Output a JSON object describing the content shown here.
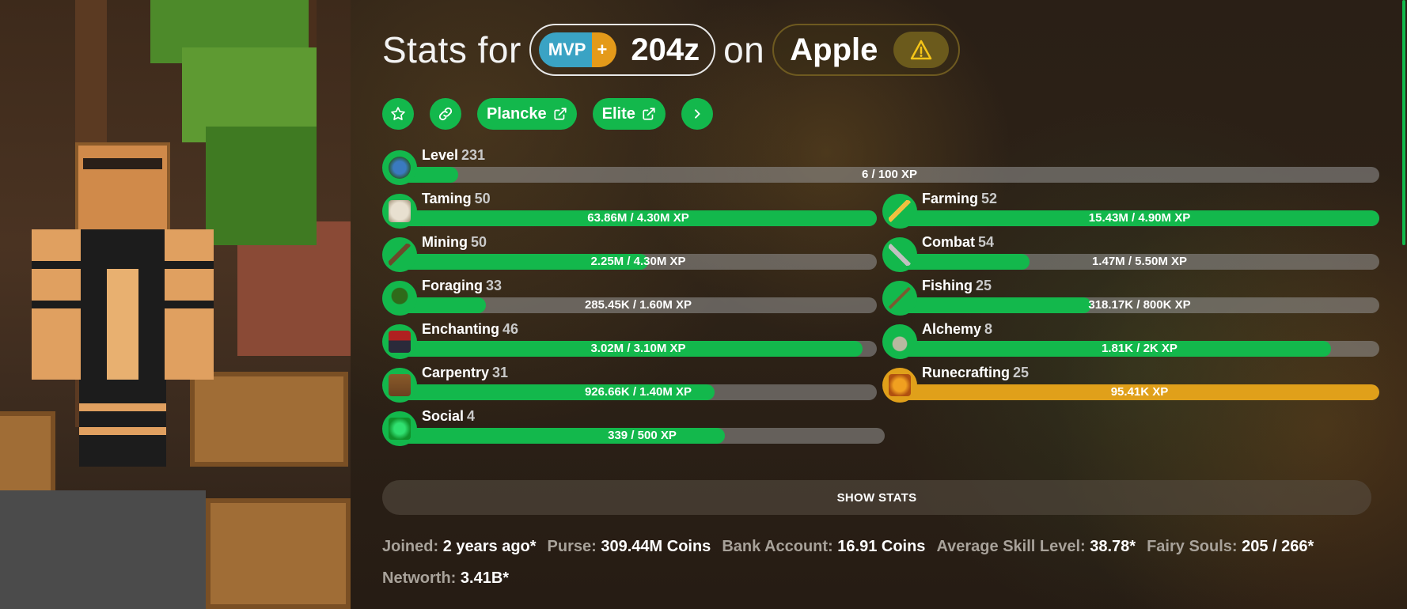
{
  "header": {
    "stats_for": "Stats for",
    "rank_main": "MVP",
    "rank_plus": "+",
    "player": "204z",
    "on": "on",
    "profile": "Apple",
    "warning_icon": "warning-triangle-icon"
  },
  "links": {
    "favorite_icon": "star-icon",
    "share_icon": "link-icon",
    "plancke": "Plancke",
    "elite": "Elite",
    "more_icon": "chevron-right-icon"
  },
  "level": {
    "name": "Level",
    "value": "231",
    "xp": "6 / 100 XP",
    "progress": 0.06
  },
  "skills": [
    {
      "name": "Taming",
      "level": "50",
      "xp": "63.86M / 4.30M XP",
      "progress": 1.0,
      "icon": "spawn-egg-icon",
      "color": "#13b84c"
    },
    {
      "name": "Farming",
      "level": "52",
      "xp": "15.43M / 4.90M XP",
      "progress": 1.0,
      "icon": "golden-hoe-icon",
      "color": "#13b84c"
    },
    {
      "name": "Mining",
      "level": "50",
      "xp": "2.25M / 4.30M XP",
      "progress": 0.52,
      "icon": "pickaxe-icon",
      "color": "#13b84c"
    },
    {
      "name": "Combat",
      "level": "54",
      "xp": "1.47M / 5.50M XP",
      "progress": 0.27,
      "icon": "sword-icon",
      "color": "#13b84c"
    },
    {
      "name": "Foraging",
      "level": "33",
      "xp": "285.45K / 1.60M XP",
      "progress": 0.18,
      "icon": "sapling-icon",
      "color": "#13b84c"
    },
    {
      "name": "Fishing",
      "level": "25",
      "xp": "318.17K / 800K XP",
      "progress": 0.4,
      "icon": "fishing-rod-icon",
      "color": "#13b84c"
    },
    {
      "name": "Enchanting",
      "level": "46",
      "xp": "3.02M / 3.10M XP",
      "progress": 0.97,
      "icon": "enchanting-table-icon",
      "color": "#13b84c"
    },
    {
      "name": "Alchemy",
      "level": "8",
      "xp": "1.81K / 2K XP",
      "progress": 0.9,
      "icon": "brewing-stand-icon",
      "color": "#13b84c"
    },
    {
      "name": "Carpentry",
      "level": "31",
      "xp": "926.66K / 1.40M XP",
      "progress": 0.66,
      "icon": "crafting-table-icon",
      "color": "#13b84c"
    },
    {
      "name": "Runecrafting",
      "level": "25",
      "xp": "95.41K XP",
      "progress": 1.0,
      "icon": "magma-cream-icon",
      "color": "#e0a01a"
    },
    {
      "name": "Social",
      "level": "4",
      "xp": "339 / 500 XP",
      "progress": 0.67,
      "icon": "emerald-icon",
      "color": "#13b84c"
    }
  ],
  "show_stats": "SHOW STATS",
  "info": {
    "joined_label": "Joined:",
    "joined_value": "2 years ago*",
    "purse_label": "Purse:",
    "purse_value": "309.44M Coins",
    "bank_label": "Bank Account:",
    "bank_value": "16.91 Coins",
    "avg_label": "Average Skill Level:",
    "avg_value": "38.78*",
    "fairy_label": "Fairy Souls:",
    "fairy_value": "205 / 266*",
    "networth_label": "Networth:",
    "networth_value": "3.41B*"
  }
}
